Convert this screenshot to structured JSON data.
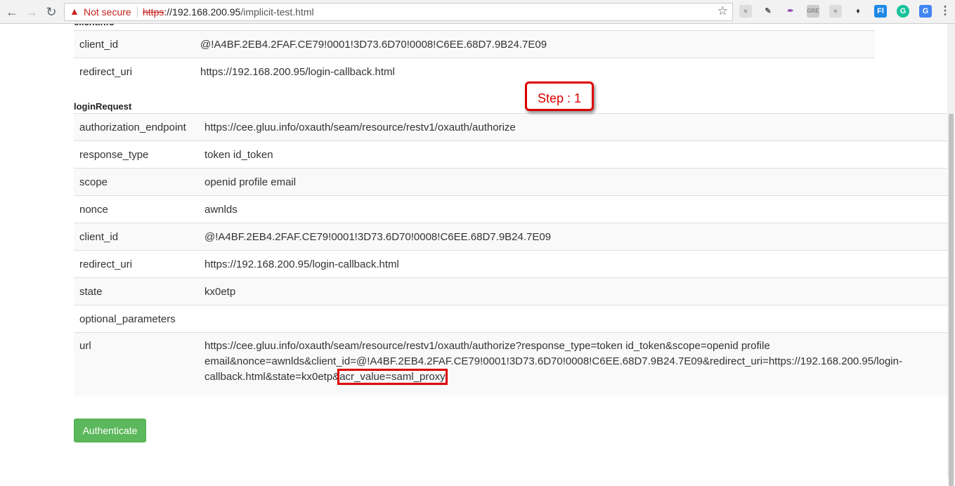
{
  "browser": {
    "security_label": "Not secure",
    "url_scheme": "https",
    "url_rest": "://192.168.200.95",
    "url_path": "/implicit-test.html"
  },
  "page": {
    "clientinfo_heading": "clientInfo",
    "client_info": [
      {
        "key": "client_id",
        "value": "@!A4BF.2EB4.2FAF.CE79!0001!3D73.6D70!0008!C6EE.68D7.9B24.7E09"
      },
      {
        "key": "redirect_uri",
        "value": "https://192.168.200.95/login-callback.html"
      }
    ],
    "login_request_heading": "loginRequest",
    "login_request": [
      {
        "key": "authorization_endpoint",
        "value": "https://cee.gluu.info/oxauth/seam/resource/restv1/oxauth/authorize"
      },
      {
        "key": "response_type",
        "value": "token id_token"
      },
      {
        "key": "scope",
        "value": "openid profile email"
      },
      {
        "key": "nonce",
        "value": "awnlds"
      },
      {
        "key": "client_id",
        "value": "@!A4BF.2EB4.2FAF.CE79!0001!3D73.6D70!0008!C6EE.68D7.9B24.7E09"
      },
      {
        "key": "redirect_uri",
        "value": "https://192.168.200.95/login-callback.html"
      },
      {
        "key": "state",
        "value": "kx0etp"
      },
      {
        "key": "optional_parameters",
        "value": ""
      }
    ],
    "url_key": "url",
    "url_value_main": "https://cee.gluu.info/oxauth/seam/resource/restv1/oxauth/authorize?response_type=token id_token&scope=openid profile email&nonce=awnlds&client_id=@!A4BF.2EB4.2FAF.CE79!0001!3D73.6D70!0008!C6EE.68D7.9B24.7E09&redirect_uri=https://192.168.200.95/login-callback.html&state=kx0etp&",
    "url_value_highlight": "acr_value=saml_proxy",
    "step_callout": "Step : 1",
    "authenticate_label": "Authenticate"
  },
  "colors": {
    "button": "#5cb85c",
    "highlight": "#dd0000"
  }
}
